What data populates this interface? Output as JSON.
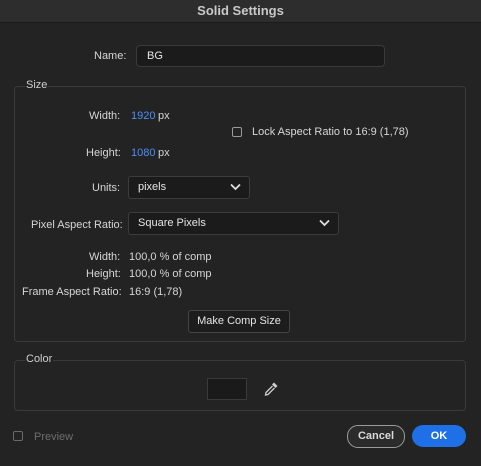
{
  "window": {
    "title": "Solid Settings"
  },
  "name": {
    "label": "Name:",
    "value": "BG"
  },
  "size": {
    "group_title": "Size",
    "width_label": "Width:",
    "width_value": "1920",
    "width_unit": "px",
    "height_label": "Height:",
    "height_value": "1080",
    "height_unit": "px",
    "lock_aspect_label": "Lock Aspect Ratio to 16:9 (1,78)",
    "lock_aspect_checked": false,
    "units_label": "Units:",
    "units_value": "pixels",
    "pixel_aspect_label": "Pixel Aspect Ratio:",
    "pixel_aspect_value": "Square Pixels",
    "info_width_label": "Width:",
    "info_width_value": "100,0 % of comp",
    "info_height_label": "Height:",
    "info_height_value": "100,0 % of comp",
    "frame_aspect_label": "Frame Aspect Ratio:",
    "frame_aspect_value": "16:9 (1,78)",
    "make_comp_size_label": "Make Comp Size"
  },
  "color": {
    "group_title": "Color",
    "swatch": "#1a1a1a",
    "eyedropper_icon": "eyedropper-icon"
  },
  "footer": {
    "preview_label": "Preview",
    "preview_checked": false,
    "cancel_label": "Cancel",
    "ok_label": "OK"
  },
  "colors": {
    "accent": "#1f6fe6",
    "value_blue": "#4f8ff7",
    "background": "#232323"
  }
}
